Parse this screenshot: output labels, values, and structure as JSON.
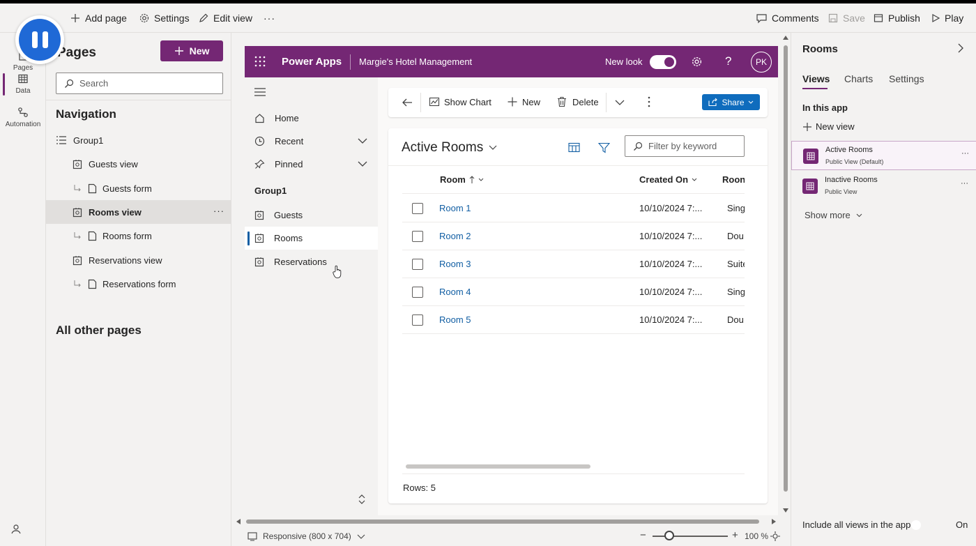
{
  "commandbar": {
    "back_label": "Back",
    "add_page": "Add page",
    "settings": "Settings",
    "edit_view": "Edit view",
    "more": "···",
    "comments": "Comments",
    "save": "Save",
    "publish": "Publish",
    "play": "Play"
  },
  "rail": {
    "items": [
      {
        "label": "Pages",
        "icon": "pages-icon"
      },
      {
        "label": "Data",
        "icon": "table-icon"
      },
      {
        "label": "Automation",
        "icon": "flow-icon"
      }
    ],
    "bottom_icon": "copilot-icon"
  },
  "pages_panel": {
    "title": "Pages",
    "new_button": "New",
    "search_placeholder": "Search",
    "navigation_title": "Navigation",
    "items": [
      {
        "label": "Group1",
        "type": "group"
      },
      {
        "label": "Guests view",
        "type": "view"
      },
      {
        "label": "Guests form",
        "type": "form"
      },
      {
        "label": "Rooms view",
        "type": "view",
        "selected": true,
        "more": "···"
      },
      {
        "label": "Rooms form",
        "type": "form"
      },
      {
        "label": "Reservations view",
        "type": "view"
      },
      {
        "label": "Reservations form",
        "type": "form"
      }
    ],
    "other_title": "All other pages"
  },
  "app": {
    "brand": "Power Apps",
    "app_name": "Margie's Hotel Management",
    "new_look": "New look",
    "avatar": "PK",
    "header_color": "#742774",
    "sitemap": {
      "home": "Home",
      "recent": "Recent",
      "pinned": "Pinned",
      "group": "Group1",
      "items": [
        "Guests",
        "Rooms",
        "Reservations"
      ],
      "selected": "Rooms"
    },
    "commands": {
      "show_chart": "Show Chart",
      "new": "New",
      "delete": "Delete",
      "share": "Share"
    },
    "grid": {
      "view_title": "Active Rooms",
      "filter_placeholder": "Filter by keyword",
      "columns": [
        "Room",
        "Created On",
        "Roon"
      ],
      "rows": [
        {
          "room": "Room 1",
          "created": "10/10/2024 7:...",
          "type": "Sing"
        },
        {
          "room": "Room 2",
          "created": "10/10/2024 7:...",
          "type": "Dou"
        },
        {
          "room": "Room 3",
          "created": "10/10/2024 7:...",
          "type": "Suite"
        },
        {
          "room": "Room 4",
          "created": "10/10/2024 7:...",
          "type": "Sing"
        },
        {
          "room": "Room 5",
          "created": "10/10/2024 7:...",
          "type": "Dou"
        }
      ],
      "footer": "Rows: 5"
    }
  },
  "right_panel": {
    "title": "Rooms",
    "tabs": [
      "Views",
      "Charts",
      "Settings"
    ],
    "section": "In this app",
    "new_view": "New view",
    "views": [
      {
        "name": "Active Rooms",
        "sub": "Public View (Default)",
        "selected": true
      },
      {
        "name": "Inactive Rooms",
        "sub": "Public View"
      }
    ],
    "show_more": "Show more",
    "include_all": "Include all views in the app",
    "toggle_state": "On"
  },
  "bottombar": {
    "responsive": "Responsive (800 x 704)",
    "zoom": "100 %"
  }
}
